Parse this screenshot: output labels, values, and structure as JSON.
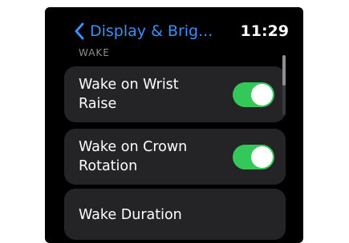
{
  "nav": {
    "back_title": "Display & Brig...",
    "back_icon": "chevron-left-icon",
    "time": "11:29"
  },
  "section": {
    "header": "WAKE"
  },
  "rows": [
    {
      "label": "Wake on Wrist Raise",
      "control": "toggle",
      "on": true
    },
    {
      "label": "Wake on Crown Rotation",
      "control": "toggle",
      "on": true
    },
    {
      "label": "Wake Duration",
      "control": "disclosure"
    }
  ],
  "colors": {
    "accent": "#3d8ff5",
    "toggle_on": "#34c759",
    "row_background": "#242426",
    "screen_background": "#000000",
    "section_header": "#8e8e93"
  }
}
